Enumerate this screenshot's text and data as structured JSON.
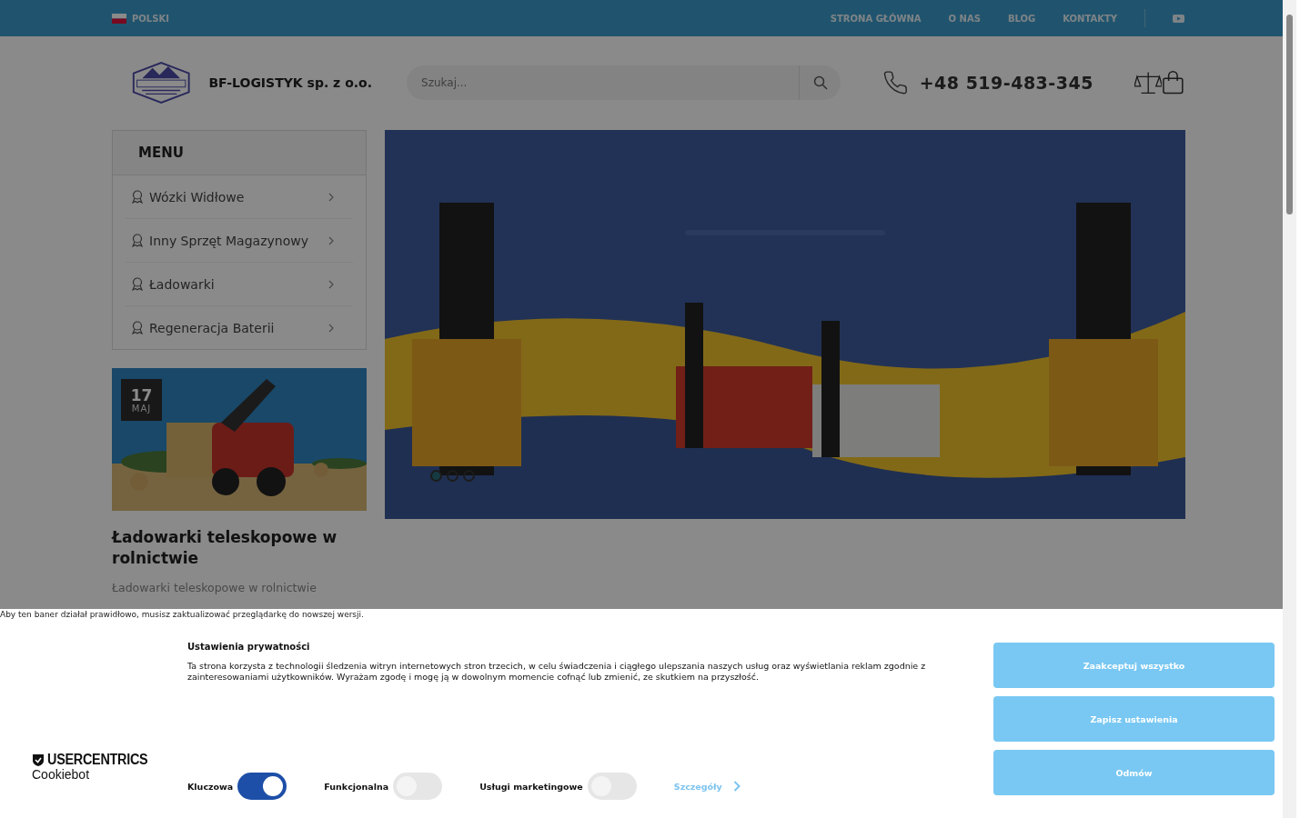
{
  "topbar": {
    "language": "POLSKI",
    "nav": [
      "STRONA GŁÓWNA",
      "O NAS",
      "BLOG",
      "KONTAKTY"
    ]
  },
  "header": {
    "company": "BF-LOGISTYK sp. z o.o.",
    "search": {
      "placeholder": "Szukaj..."
    },
    "phone": "+48 519-483-345"
  },
  "menu": {
    "title": "MENU",
    "items": [
      "Wózki Widłowe",
      "Inny Sprzęt Magazynowy",
      "Ładowarki",
      "Regeneracja Baterii"
    ]
  },
  "post": {
    "day": "17",
    "month": "MAJ",
    "title": "Ładowarki teleskopowe w rolnictwie",
    "excerpt": "Ładowarki teleskopowe w rolnictwie"
  },
  "hero": {
    "kind": "picture",
    "dots": [
      {
        "selected": true
      },
      {
        "selected": false
      },
      {
        "selected": false
      }
    ]
  },
  "cookie": {
    "notice": "Aby ten baner działał prawidłowo, musisz zaktualizować przeglądarkę do nowszej wersji.",
    "brand": "USERCENTRICS",
    "product": "Cookiebot",
    "title": "Ustawienia prywatności",
    "text": "Ta strona korzysta z technologii śledzenia witryn internetowych stron trzecich, w celu świadczenia i ciągłego ulepszania naszych usług oraz wyświetlania reklam zgodnie z zainteresowaniami użytkowników. Wyrażam zgodę i mogę ją w dowolnym momencie cofnąć lub zmienić, ze skutkiem na przyszłość.",
    "toggles": [
      {
        "label": "Kluczowa",
        "on": true
      },
      {
        "label": "Funkcjonalna",
        "on": false
      },
      {
        "label": "Usługi marketingowe",
        "on": false
      }
    ],
    "details": "Szczegóły",
    "buttons": [
      "Zaakceptuj wszystko",
      "Zapisz ustawienia",
      "Odmów"
    ]
  }
}
